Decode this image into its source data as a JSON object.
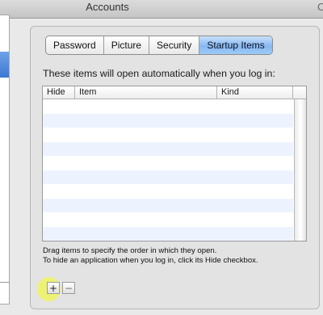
{
  "window": {
    "title": "Accounts",
    "edge_glyph": "C"
  },
  "tabs": [
    {
      "label": "Password"
    },
    {
      "label": "Picture"
    },
    {
      "label": "Security"
    },
    {
      "label": "Startup Items",
      "selected": true
    }
  ],
  "startup": {
    "intro": "These items will open automatically when you log in:",
    "columns": [
      {
        "label": "Hide"
      },
      {
        "label": "Item"
      },
      {
        "label": "Kind"
      }
    ],
    "rows": [],
    "hint_line1": "Drag items to specify the order in which they open.",
    "hint_line2": "To hide an application when you log in, click its Hide checkbox."
  },
  "buttons": {
    "add": "+",
    "remove": "−"
  }
}
